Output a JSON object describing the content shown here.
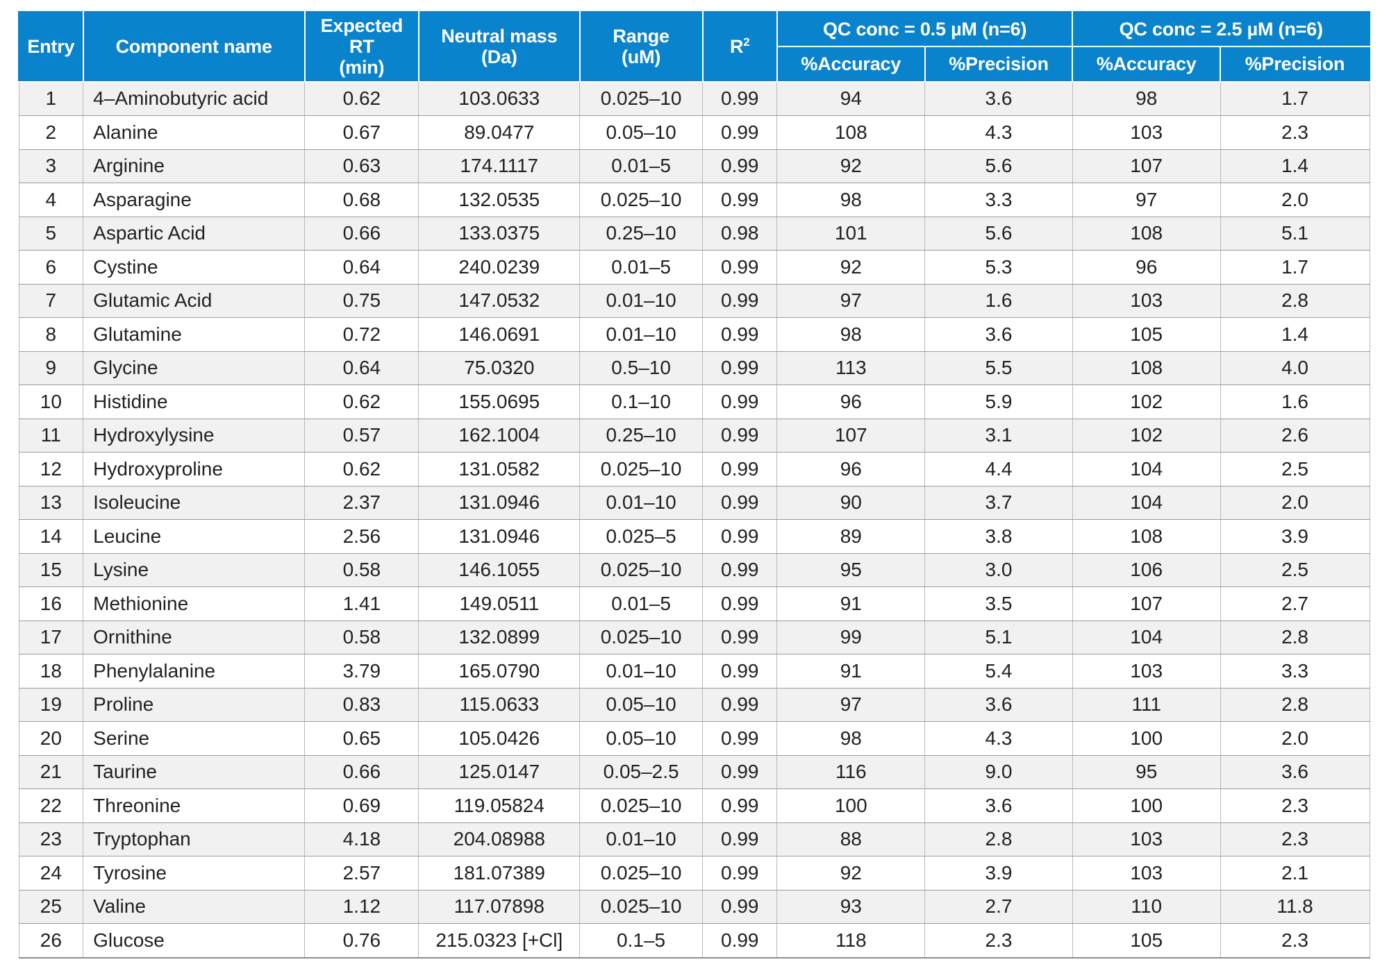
{
  "table": {
    "header": {
      "entry": "Entry",
      "component_name": "Component name",
      "expected_rt_l1": "Expected RT",
      "expected_rt_l2": "(min)",
      "neutral_mass_l1": "Neutral mass",
      "neutral_mass_l2": "(Da)",
      "range_l1": "Range",
      "range_l2": "(uM)",
      "r2_base": "R",
      "r2_sup": "2",
      "qc_group_1": "QC conc = 0.5 µM (n=6)",
      "qc_group_2": "QC conc = 2.5 µM (n=6)",
      "accuracy_1": "%Accuracy",
      "precision_1": "%Precision",
      "accuracy_2": "%Accuracy",
      "precision_2": "%Precision"
    },
    "header_color": "#0a83cd",
    "header_text_color": "#ffffff",
    "stripe_color": "#f1f1f1",
    "rows": [
      {
        "entry": "1",
        "name": "4–Aminobutyric acid",
        "rt": "0.62",
        "mass": "103.0633",
        "range": "0.025–10",
        "r2": "0.99",
        "acc1": "94",
        "pre1": "3.6",
        "acc2": "98",
        "pre2": "1.7"
      },
      {
        "entry": "2",
        "name": "Alanine",
        "rt": "0.67",
        "mass": "89.0477",
        "range": "0.05–10",
        "r2": "0.99",
        "acc1": "108",
        "pre1": "4.3",
        "acc2": "103",
        "pre2": "2.3"
      },
      {
        "entry": "3",
        "name": "Arginine",
        "rt": "0.63",
        "mass": "174.1117",
        "range": "0.01–5",
        "r2": "0.99",
        "acc1": "92",
        "pre1": "5.6",
        "acc2": "107",
        "pre2": "1.4"
      },
      {
        "entry": "4",
        "name": "Asparagine",
        "rt": "0.68",
        "mass": "132.0535",
        "range": "0.025–10",
        "r2": "0.99",
        "acc1": "98",
        "pre1": "3.3",
        "acc2": "97",
        "pre2": "2.0"
      },
      {
        "entry": "5",
        "name": "Aspartic Acid",
        "rt": "0.66",
        "mass": "133.0375",
        "range": "0.25–10",
        "r2": "0.98",
        "acc1": "101",
        "pre1": "5.6",
        "acc2": "108",
        "pre2": "5.1"
      },
      {
        "entry": "6",
        "name": "Cystine",
        "rt": "0.64",
        "mass": "240.0239",
        "range": "0.01–5",
        "r2": "0.99",
        "acc1": "92",
        "pre1": "5.3",
        "acc2": "96",
        "pre2": "1.7"
      },
      {
        "entry": "7",
        "name": "Glutamic Acid",
        "rt": "0.75",
        "mass": "147.0532",
        "range": "0.01–10",
        "r2": "0.99",
        "acc1": "97",
        "pre1": "1.6",
        "acc2": "103",
        "pre2": "2.8"
      },
      {
        "entry": "8",
        "name": "Glutamine",
        "rt": "0.72",
        "mass": "146.0691",
        "range": "0.01–10",
        "r2": "0.99",
        "acc1": "98",
        "pre1": "3.6",
        "acc2": "105",
        "pre2": "1.4"
      },
      {
        "entry": "9",
        "name": "Glycine",
        "rt": "0.64",
        "mass": "75.0320",
        "range": "0.5–10",
        "r2": "0.99",
        "acc1": "113",
        "pre1": "5.5",
        "acc2": "108",
        "pre2": "4.0"
      },
      {
        "entry": "10",
        "name": "Histidine",
        "rt": "0.62",
        "mass": "155.0695",
        "range": "0.1–10",
        "r2": "0.99",
        "acc1": "96",
        "pre1": "5.9",
        "acc2": "102",
        "pre2": "1.6"
      },
      {
        "entry": "11",
        "name": "Hydroxylysine",
        "rt": "0.57",
        "mass": "162.1004",
        "range": "0.25–10",
        "r2": "0.99",
        "acc1": "107",
        "pre1": "3.1",
        "acc2": "102",
        "pre2": "2.6"
      },
      {
        "entry": "12",
        "name": "Hydroxyproline",
        "rt": "0.62",
        "mass": "131.0582",
        "range": "0.025–10",
        "r2": "0.99",
        "acc1": "96",
        "pre1": "4.4",
        "acc2": "104",
        "pre2": "2.5"
      },
      {
        "entry": "13",
        "name": "Isoleucine",
        "rt": "2.37",
        "mass": "131.0946",
        "range": "0.01–10",
        "r2": "0.99",
        "acc1": "90",
        "pre1": "3.7",
        "acc2": "104",
        "pre2": "2.0"
      },
      {
        "entry": "14",
        "name": "Leucine",
        "rt": "2.56",
        "mass": "131.0946",
        "range": "0.025–5",
        "r2": "0.99",
        "acc1": "89",
        "pre1": "3.8",
        "acc2": "108",
        "pre2": "3.9"
      },
      {
        "entry": "15",
        "name": "Lysine",
        "rt": "0.58",
        "mass": "146.1055",
        "range": "0.025–10",
        "r2": "0.99",
        "acc1": "95",
        "pre1": "3.0",
        "acc2": "106",
        "pre2": "2.5"
      },
      {
        "entry": "16",
        "name": "Methionine",
        "rt": "1.41",
        "mass": "149.0511",
        "range": "0.01–5",
        "r2": "0.99",
        "acc1": "91",
        "pre1": "3.5",
        "acc2": "107",
        "pre2": "2.7"
      },
      {
        "entry": "17",
        "name": "Ornithine",
        "rt": "0.58",
        "mass": "132.0899",
        "range": "0.025–10",
        "r2": "0.99",
        "acc1": "99",
        "pre1": "5.1",
        "acc2": "104",
        "pre2": "2.8"
      },
      {
        "entry": "18",
        "name": "Phenylalanine",
        "rt": "3.79",
        "mass": "165.0790",
        "range": "0.01–10",
        "r2": "0.99",
        "acc1": "91",
        "pre1": "5.4",
        "acc2": "103",
        "pre2": "3.3"
      },
      {
        "entry": "19",
        "name": "Proline",
        "rt": "0.83",
        "mass": "115.0633",
        "range": "0.05–10",
        "r2": "0.99",
        "acc1": "97",
        "pre1": "3.6",
        "acc2": "111",
        "pre2": "2.8"
      },
      {
        "entry": "20",
        "name": "Serine",
        "rt": "0.65",
        "mass": "105.0426",
        "range": "0.05–10",
        "r2": "0.99",
        "acc1": "98",
        "pre1": "4.3",
        "acc2": "100",
        "pre2": "2.0"
      },
      {
        "entry": "21",
        "name": "Taurine",
        "rt": "0.66",
        "mass": "125.0147",
        "range": "0.05–2.5",
        "r2": "0.99",
        "acc1": "116",
        "pre1": "9.0",
        "acc2": "95",
        "pre2": "3.6"
      },
      {
        "entry": "22",
        "name": "Threonine",
        "rt": "0.69",
        "mass": "119.05824",
        "range": "0.025–10",
        "r2": "0.99",
        "acc1": "100",
        "pre1": "3.6",
        "acc2": "100",
        "pre2": "2.3"
      },
      {
        "entry": "23",
        "name": "Tryptophan",
        "rt": "4.18",
        "mass": "204.08988",
        "range": "0.01–10",
        "r2": "0.99",
        "acc1": "88",
        "pre1": "2.8",
        "acc2": "103",
        "pre2": "2.3"
      },
      {
        "entry": "24",
        "name": "Tyrosine",
        "rt": "2.57",
        "mass": "181.07389",
        "range": "0.025–10",
        "r2": "0.99",
        "acc1": "92",
        "pre1": "3.9",
        "acc2": "103",
        "pre2": "2.1"
      },
      {
        "entry": "25",
        "name": "Valine",
        "rt": "1.12",
        "mass": "117.07898",
        "range": "0.025–10",
        "r2": "0.99",
        "acc1": "93",
        "pre1": "2.7",
        "acc2": "110",
        "pre2": "11.8"
      },
      {
        "entry": "26",
        "name": "Glucose",
        "rt": "0.76",
        "mass": "215.0323 [+Cl]",
        "range": "0.1–5",
        "r2": "0.99",
        "acc1": "118",
        "pre1": "2.3",
        "acc2": "105",
        "pre2": "2.3"
      }
    ]
  }
}
